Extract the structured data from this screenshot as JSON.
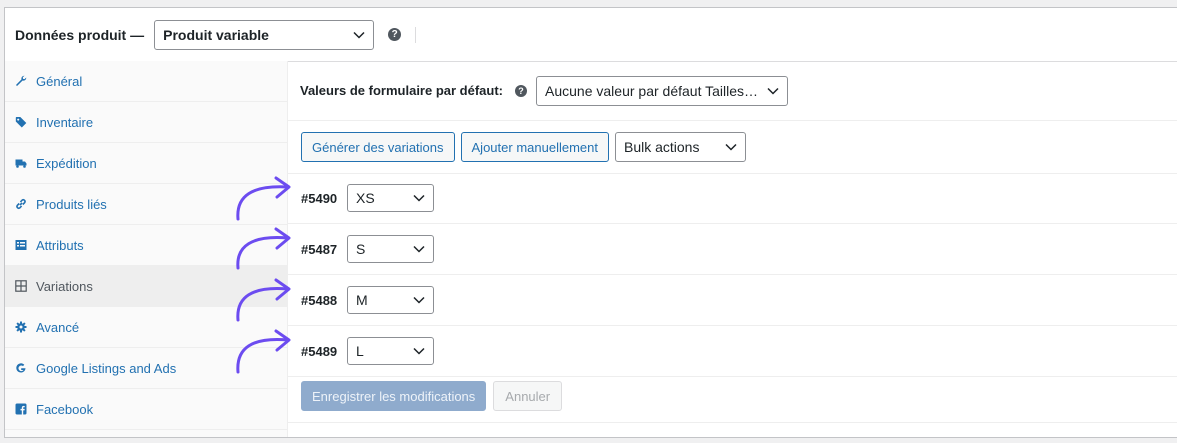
{
  "header": {
    "title": "Données produit —",
    "product_type": "Produit variable",
    "help": "?"
  },
  "sidebar": {
    "items": [
      {
        "label": "Général",
        "icon": "wrench-icon"
      },
      {
        "label": "Inventaire",
        "icon": "tag-icon"
      },
      {
        "label": "Expédition",
        "icon": "truck-icon"
      },
      {
        "label": "Produits liés",
        "icon": "link-icon"
      },
      {
        "label": "Attributs",
        "icon": "list-icon"
      },
      {
        "label": "Variations",
        "icon": "grid-icon",
        "active": true
      },
      {
        "label": "Avancé",
        "icon": "gear-icon"
      },
      {
        "label": "Google Listings and Ads",
        "icon": "google-icon"
      },
      {
        "label": "Facebook",
        "icon": "facebook-icon"
      }
    ]
  },
  "defaults": {
    "label": "Valeurs de formulaire par défaut:",
    "help": "?",
    "value": "Aucune valeur par défaut Tailles…"
  },
  "toolbar": {
    "generate_label": "Générer des variations",
    "add_manual_label": "Ajouter manuellement",
    "bulk_actions": "Bulk actions"
  },
  "variations": [
    {
      "id": "#5490",
      "size": "XS"
    },
    {
      "id": "#5487",
      "size": "S"
    },
    {
      "id": "#5488",
      "size": "M"
    },
    {
      "id": "#5489",
      "size": "L"
    }
  ],
  "actions": {
    "save_label": "Enregistrer les modifications",
    "cancel_label": "Annuler"
  },
  "colors": {
    "link": "#2271b1",
    "arrow": "#6c4cf0",
    "primary_disabled": "#8fabcd"
  }
}
